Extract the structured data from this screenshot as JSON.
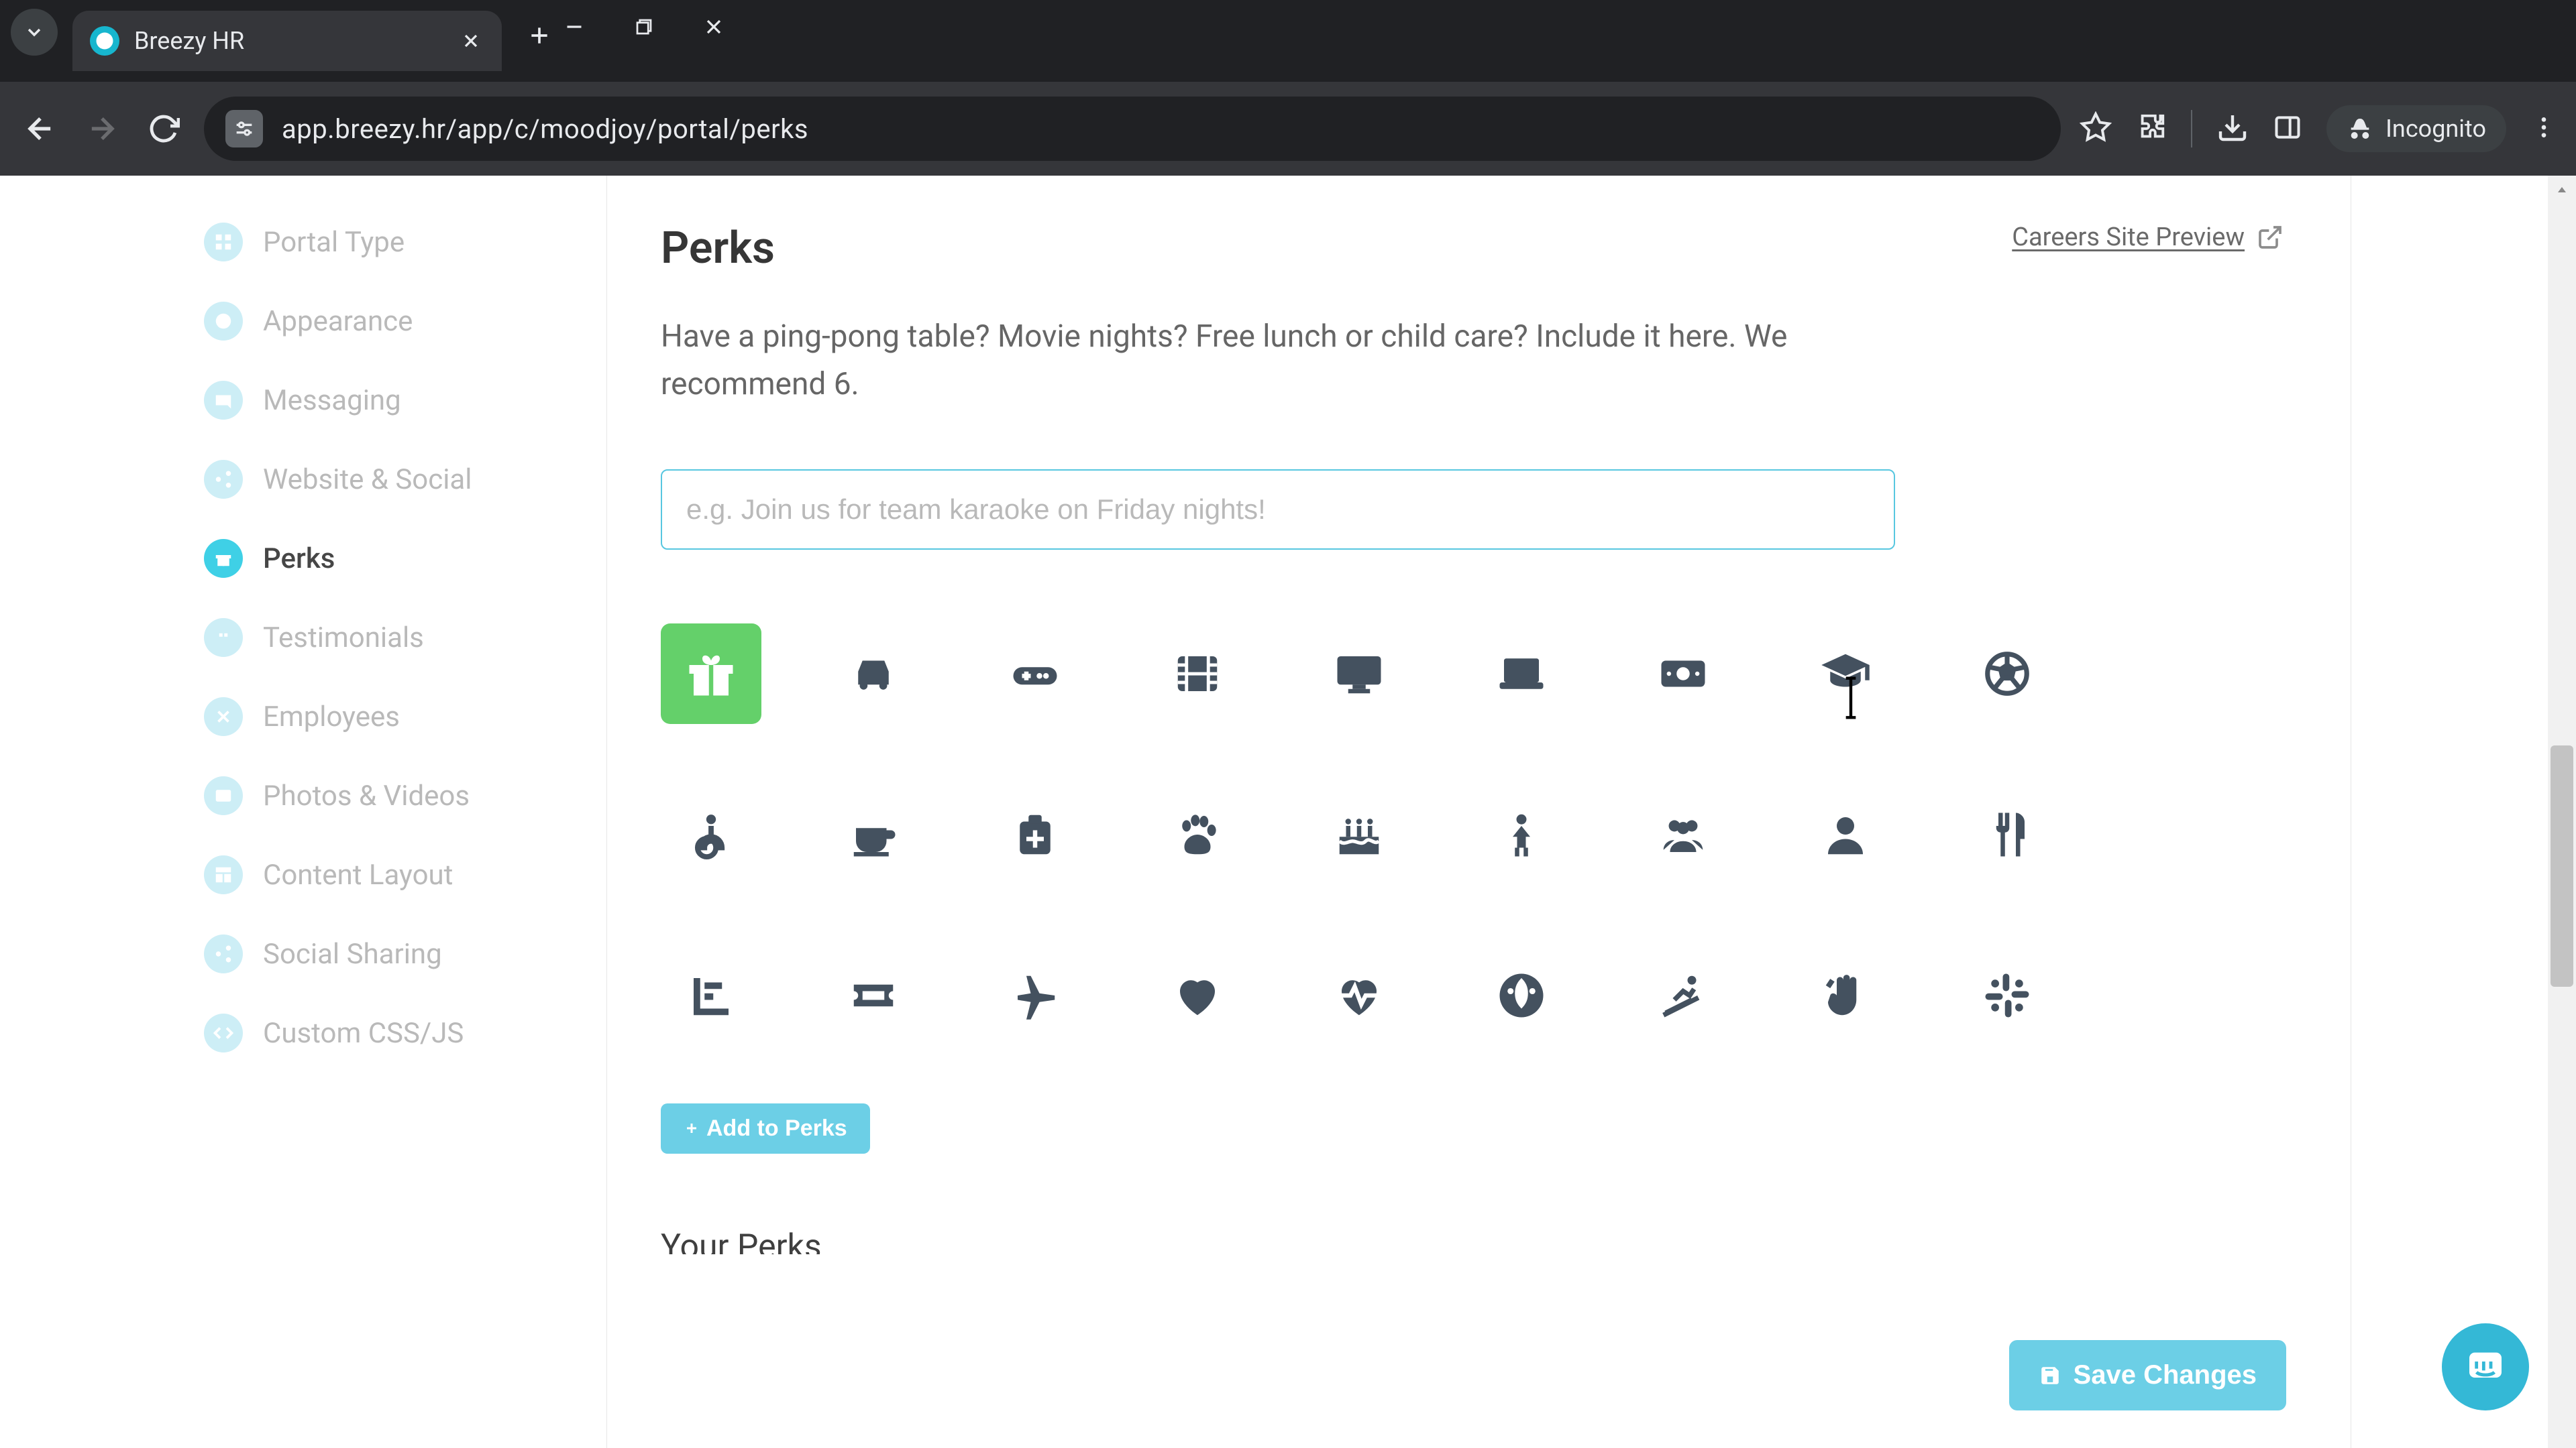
{
  "browser": {
    "tab_title": "Breezy HR",
    "url": "app.breezy.hr/app/c/moodjoy/portal/perks",
    "incognito_label": "Incognito"
  },
  "sidebar": {
    "items": [
      {
        "label": "Portal Type",
        "icon": "grid-icon"
      },
      {
        "label": "Appearance",
        "icon": "palette-icon"
      },
      {
        "label": "Messaging",
        "icon": "message-icon"
      },
      {
        "label": "Website & Social",
        "icon": "share-icon"
      },
      {
        "label": "Perks",
        "icon": "gift-icon",
        "active": true
      },
      {
        "label": "Testimonials",
        "icon": "quote-icon"
      },
      {
        "label": "Employees",
        "icon": "x-icon"
      },
      {
        "label": "Photos & Videos",
        "icon": "image-icon"
      },
      {
        "label": "Content Layout",
        "icon": "layout-icon"
      },
      {
        "label": "Social Sharing",
        "icon": "share2-icon"
      },
      {
        "label": "Custom CSS/JS",
        "icon": "code-icon"
      }
    ]
  },
  "main": {
    "title": "Perks",
    "preview_label": "Careers Site Preview",
    "subtitle": "Have a ping-pong table? Movie nights? Free lunch or child care? Include it here. We recommend 6.",
    "input_placeholder": "e.g. Join us for team karaoke on Friday nights!",
    "add_button": "Add to Perks",
    "peek": "Your Perks",
    "save_button": "Save Changes"
  }
}
